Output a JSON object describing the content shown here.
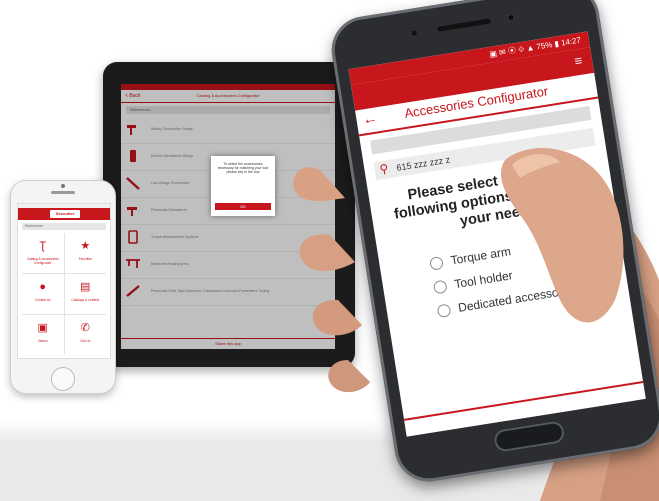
{
  "tablet": {
    "nav_title": "Catalog & Accessories Configurator",
    "back": "< Back",
    "search_placeholder": "Références",
    "rows": [
      "Battery Screwdriver Range",
      "Electric Screwdriver Range",
      "Low Voltage Screwdriver",
      "Pneumatic Screwdriver",
      "Torque Measurement Systems",
      "Balancers Holding Arms",
      "Pneumatic Drills Taps Nutrunner, Transducers Level and Parameters Tooling"
    ],
    "popup": {
      "message": "To select the accessories necessary for matching your tool please key in the tool",
      "button": "OK"
    },
    "bottom_label": "Share this app"
  },
  "iphone": {
    "logo": "Desoutter",
    "search_placeholder": "Rechercher",
    "tiles": [
      {
        "icon": "screwdriver-icon",
        "glyph": "Ʈ",
        "label": "Catalog & Accessories Configurator"
      },
      {
        "icon": "star-icon",
        "glyph": "★",
        "label": "Favorites"
      },
      {
        "icon": "chat-icon",
        "glyph": "●",
        "label": "Contact Us"
      },
      {
        "icon": "catalog-icon",
        "glyph": "▤",
        "label": "Catalogs & Leaflets"
      },
      {
        "icon": "video-icon",
        "glyph": "▣",
        "label": "Videos"
      },
      {
        "icon": "phone-icon",
        "glyph": "✆",
        "label": "Call Us"
      }
    ]
  },
  "samsung": {
    "status": "▣ ✉ ⦿ ⟐ ▲ 75% ▮ 14:27",
    "title": "Accessories Configurator",
    "search_value": "615 zzz zzz z",
    "question": "Please select one of the following options that match your need",
    "options": [
      "Torque arm",
      "Tool holder",
      "Dedicated accessories"
    ],
    "menu_icon": "≡",
    "back_icon": "←",
    "search_icon": "⚲"
  },
  "colors": {
    "brand_red": "#c8161d",
    "device_dark": "#2b2d31"
  }
}
